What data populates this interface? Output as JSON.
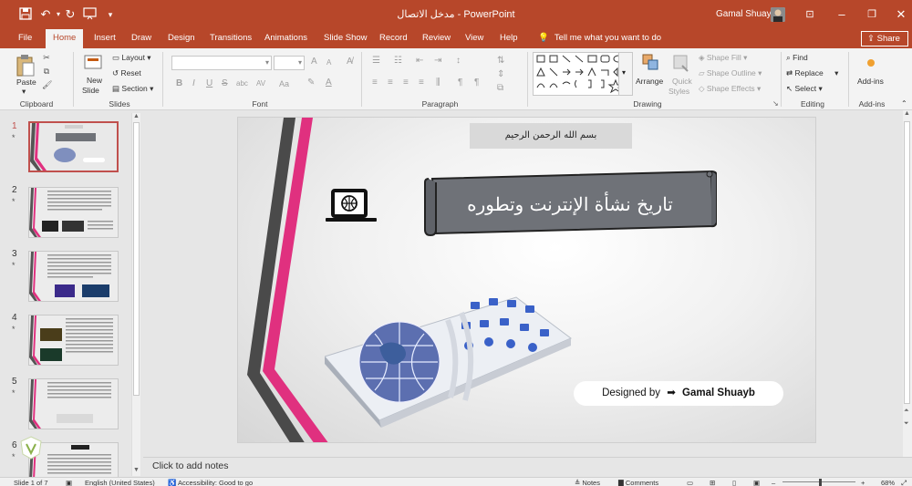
{
  "window": {
    "title": "مدخل الاتصال  -  PowerPoint",
    "user_name": "Gamal Shuayb"
  },
  "ribbon_tabs": [
    "File",
    "Home",
    "Insert",
    "Draw",
    "Design",
    "Transitions",
    "Animations",
    "Slide Show",
    "Record",
    "Review",
    "View",
    "Help"
  ],
  "tell_me": "Tell me what you want to do",
  "share_label": "Share",
  "clipboard": {
    "paste": "Paste",
    "label": "Clipboard"
  },
  "slides_group": {
    "new_slide_1": "New",
    "new_slide_2": "Slide",
    "layout": "Layout",
    "reset": "Reset",
    "section": "Section",
    "label": "Slides"
  },
  "font_group": {
    "label": "Font",
    "bold": "B",
    "italic": "I",
    "underline": "U",
    "strike": "S",
    "shadow": "abc",
    "spacing": "AV",
    "case": "Aa",
    "grow": "A",
    "shrink": "A"
  },
  "paragraph_group": {
    "label": "Paragraph"
  },
  "drawing_group": {
    "label": "Drawing",
    "arrange": "Arrange",
    "quick_styles_1": "Quick",
    "quick_styles_2": "Styles",
    "shape_fill": "Shape Fill",
    "shape_outline": "Shape Outline",
    "shape_effects": "Shape Effects"
  },
  "editing_group": {
    "label": "Editing",
    "find": "Find",
    "replace": "Replace",
    "select": "Select"
  },
  "addins_group": {
    "button": "Add-ins",
    "label": "Add-ins"
  },
  "thumbnails": [
    {
      "num": "1",
      "star": "*"
    },
    {
      "num": "2",
      "star": "*"
    },
    {
      "num": "3",
      "star": "*"
    },
    {
      "num": "4",
      "star": "*"
    },
    {
      "num": "5",
      "star": "*"
    },
    {
      "num": "6",
      "star": "*"
    }
  ],
  "slide": {
    "basmala": "بسم الله الرحمن الرحيم",
    "banner_title": "تاريخ نشأة الإنترنت وتطوره",
    "designed_by": "Designed by",
    "designer": "Gamal Shuayb"
  },
  "notes_placeholder": "Click to add notes",
  "status": {
    "slide_info": "Slide 1 of 7",
    "language": "English (United States)",
    "accessibility": "Accessibility: Good to go",
    "notes": "Notes",
    "comments": "Comments",
    "zoom": "68%"
  },
  "colors": {
    "brand": "#b7472a",
    "pink": "#e0307f",
    "dark_grey": "#4a4a4a",
    "banner": "#6f7278"
  }
}
